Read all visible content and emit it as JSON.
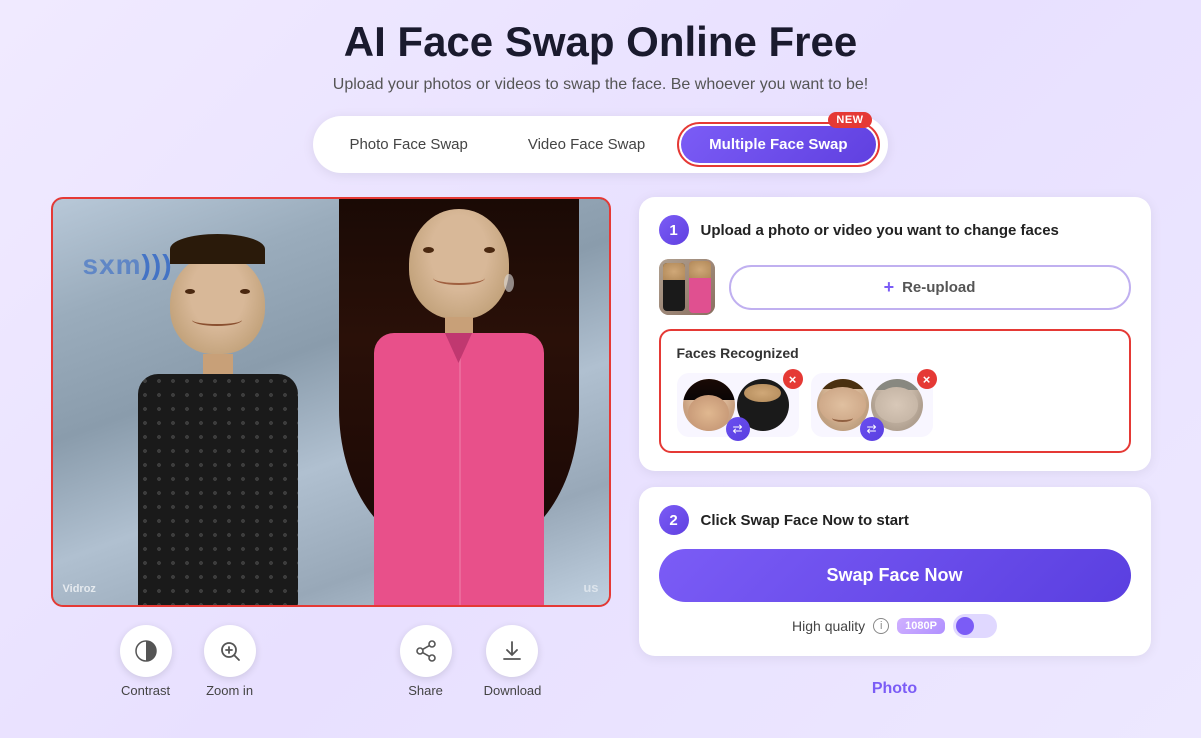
{
  "page": {
    "title": "AI Face Swap Online Free",
    "subtitle": "Upload your photos or videos to swap the face. Be whoever you want to be!"
  },
  "tabs": {
    "photo_face_swap": "Photo Face Swap",
    "video_face_swap": "Video Face Swap",
    "multiple_face_swap": "Multiple Face Swap",
    "new_badge": "NEW"
  },
  "step1": {
    "number": "1",
    "title": "Upload a photo or video you want to change faces",
    "reupload_label": "Re-upload"
  },
  "faces_recognized": {
    "title": "Faces Recognized"
  },
  "step2": {
    "number": "2",
    "title": "Click Swap Face Now to start",
    "swap_btn_label": "Swap Face Now",
    "quality_label": "High quality",
    "quality_badge": "1080P"
  },
  "toolbar": {
    "contrast_label": "Contrast",
    "zoom_in_label": "Zoom in",
    "share_label": "Share",
    "download_label": "Download"
  },
  "bottom": {
    "photo_label": "Photo"
  },
  "watermark": "Vidroz"
}
